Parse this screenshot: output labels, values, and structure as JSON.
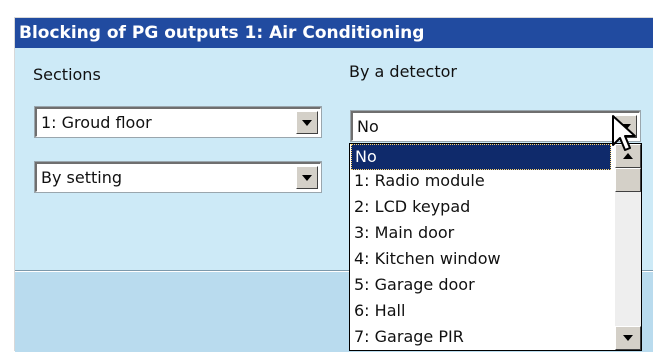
{
  "dialog": {
    "title": "Blocking of PG outputs 1: Air Conditioning"
  },
  "sections": {
    "label": "Sections",
    "section_select_value": "1: Groud floor",
    "mode_select_value": "By setting"
  },
  "detector": {
    "label": "By a detector",
    "select_value": "No",
    "options": [
      "No",
      "1: Radio module",
      "2: LCD keypad",
      "3: Main door",
      "4: Kitchen window",
      "5: Garage door",
      "6: Hall",
      "7: Garage PIR"
    ],
    "selected_index": 0
  },
  "icons": {
    "dropdown": "chevron-down-icon",
    "scroll_up": "scroll-up-icon",
    "scroll_down": "scroll-down-icon",
    "cursor": "pointer-cursor-icon"
  },
  "colors": {
    "title_bar": "#214ba0",
    "dialog_background": "#cdeaf7",
    "selection": "#0f2a6b"
  }
}
